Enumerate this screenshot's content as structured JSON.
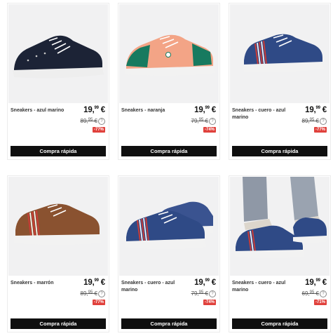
{
  "products": [
    {
      "name": "Sneakers - azul marino",
      "price_int": "19,",
      "price_dec": "99",
      "price_cur": "€",
      "old_int": "89,",
      "old_dec": "95",
      "old_cur": "€",
      "discount": "-77%",
      "help": "?",
      "cta": "Compra rápida",
      "image": "sneaker-navy-suede",
      "colors": {
        "upper": "#1c2336",
        "sole": "#eeeeee",
        "accent": "#1c2336"
      }
    },
    {
      "name": "Sneakers - naranja",
      "price_int": "19,",
      "price_dec": "99",
      "price_cur": "€",
      "old_int": "79,",
      "old_dec": "95",
      "old_cur": "€",
      "discount": "-74%",
      "help": "?",
      "cta": "Compra rápida",
      "image": "sneaker-orange-green",
      "colors": {
        "upper": "#f3a486",
        "sole": "#f2f2f2",
        "accent": "#177a5f"
      }
    },
    {
      "name": "Sneakers - cuero - azul marino",
      "price_int": "19,",
      "price_dec": "99",
      "price_cur": "€",
      "old_int": "89,",
      "old_dec": "95",
      "old_cur": "€",
      "discount": "-77%",
      "help": "?",
      "cta": "Compra rápida",
      "image": "sneaker-blue-stripes",
      "colors": {
        "upper": "#2f4a86",
        "sole": "#f2f2f2",
        "accent": "#c93b36"
      }
    },
    {
      "name": "Sneakers - marrón",
      "price_int": "19,",
      "price_dec": "99",
      "price_cur": "€",
      "old_int": "89,",
      "old_dec": "95",
      "old_cur": "€",
      "discount": "-77%",
      "help": "?",
      "cta": "Compra rápida",
      "image": "sneaker-brown-leather",
      "colors": {
        "upper": "#8a5230",
        "sole": "#f2f2f2",
        "accent": "#c93b36"
      }
    },
    {
      "name": "Sneakers - cuero - azul marino",
      "price_int": "19,",
      "price_dec": "99",
      "price_cur": "€",
      "old_int": "79,",
      "old_dec": "95",
      "old_cur": "€",
      "discount": "-74%",
      "help": "?",
      "cta": "Compra rápida",
      "image": "sneaker-blue-pair",
      "colors": {
        "upper": "#3a5390",
        "sole": "#f2f2f2",
        "accent": "#c93b36"
      }
    },
    {
      "name": "Sneakers - cuero - azul marino",
      "price_int": "19,",
      "price_dec": "99",
      "price_cur": "€",
      "old_int": "69,",
      "old_dec": "95",
      "old_cur": "€",
      "discount": "-71%",
      "help": "?",
      "cta": "Compra rápida",
      "image": "sneaker-on-foot",
      "colors": {
        "upper": "#2f4a86",
        "sole": "#f2f2f2",
        "accent": "#c93b36"
      }
    }
  ]
}
